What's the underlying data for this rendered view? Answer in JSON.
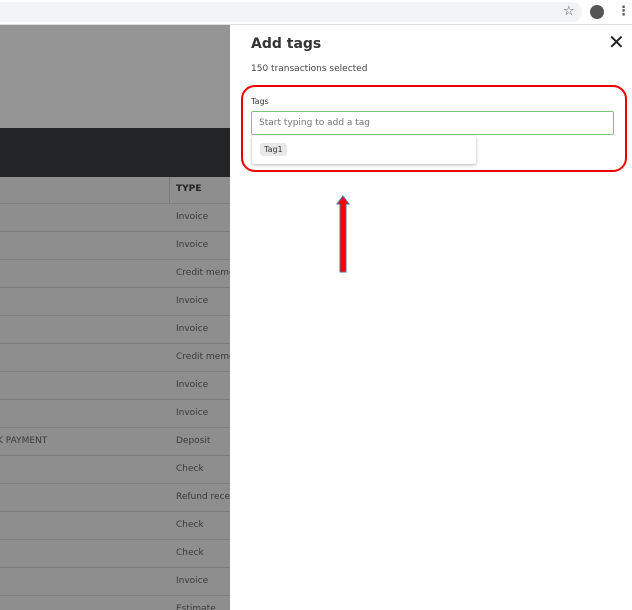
{
  "browser": {
    "star_icon": "star-icon",
    "profile_icon": "account-icon",
    "menu_icon": "more-vert-icon"
  },
  "table": {
    "type_header": "TYPE",
    "rows": [
      {
        "desc": "",
        "type": "Invoice"
      },
      {
        "desc": "",
        "type": "Invoice"
      },
      {
        "desc": "",
        "type": "Credit memo"
      },
      {
        "desc": "",
        "type": "Invoice"
      },
      {
        "desc": "",
        "type": "Invoice"
      },
      {
        "desc": "",
        "type": "Credit memo"
      },
      {
        "desc": "",
        "type": "Invoice"
      },
      {
        "desc": "",
        "type": "Invoice"
      },
      {
        "desc": "K PAYMENT",
        "type": "Deposit"
      },
      {
        "desc": "",
        "type": "Check"
      },
      {
        "desc": "",
        "type": "Refund receipt"
      },
      {
        "desc": "",
        "type": "Check"
      },
      {
        "desc": "",
        "type": "Check"
      },
      {
        "desc": "",
        "type": "Invoice"
      },
      {
        "desc": "",
        "type": "Estimate"
      }
    ]
  },
  "panel": {
    "title": "Add tags",
    "subtitle": "150 transactions selected",
    "tags_label": "Tags",
    "tags_placeholder": "Start typing to add a tag",
    "suggestion": "Tag1"
  },
  "colors": {
    "highlight": "#e00000",
    "arrow": "#ff0000",
    "input_border": "#7cc47c"
  }
}
